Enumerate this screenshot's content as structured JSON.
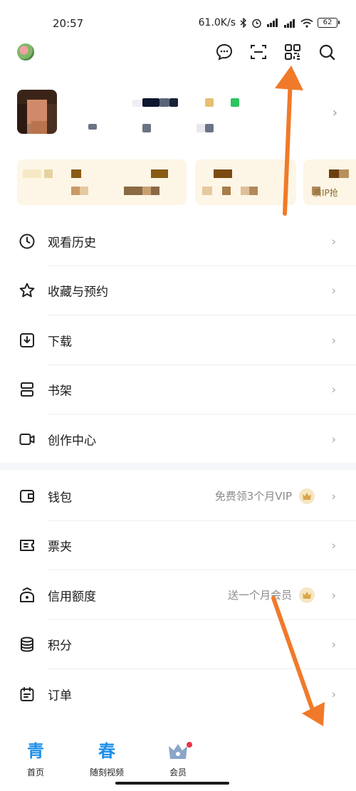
{
  "status_bar": {
    "time": "20:57",
    "net_speed": "61.0K/s",
    "battery": "62"
  },
  "top_bar": {
    "icons": [
      "message-icon",
      "scan-icon",
      "qr-code-icon",
      "search-icon"
    ]
  },
  "profile": {
    "avatar_desc": "pixelated avatar",
    "chevron": "›"
  },
  "cards": {
    "tag_text": "质IP抢"
  },
  "menu_group_1": [
    {
      "label": "观看历史",
      "icon": "clock-icon"
    },
    {
      "label": "收藏与预约",
      "icon": "star-icon"
    },
    {
      "label": "下载",
      "icon": "download-icon"
    },
    {
      "label": "书架",
      "icon": "bookshelf-icon"
    },
    {
      "label": "创作中心",
      "icon": "camera-icon"
    }
  ],
  "menu_group_2": [
    {
      "label": "钱包",
      "icon": "wallet-icon",
      "extra": "免费领3个月VIP"
    },
    {
      "label": "票夹",
      "icon": "ticket-icon"
    },
    {
      "label": "信用额度",
      "icon": "credit-icon",
      "extra": "送一个月会员"
    },
    {
      "label": "积分",
      "icon": "coins-icon"
    },
    {
      "label": "订单",
      "icon": "order-icon"
    }
  ],
  "bottom_nav": [
    {
      "label": "首页",
      "glyph": "青"
    },
    {
      "label": "随刻视频",
      "glyph": "春"
    },
    {
      "label": "会员",
      "glyph": ""
    }
  ],
  "colors": {
    "accent_blue": "#1e8fe8",
    "annotation_orange": "#f07a2a",
    "card_bg": "#fdf6e6"
  }
}
